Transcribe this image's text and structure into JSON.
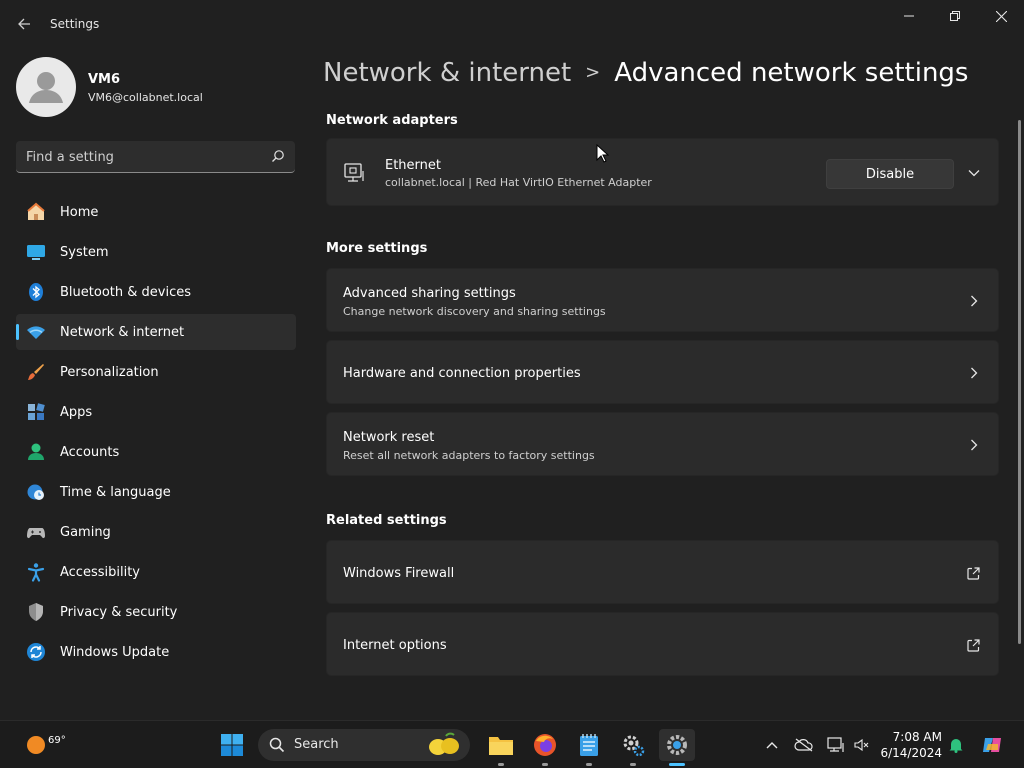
{
  "window": {
    "app_title": "Settings"
  },
  "profile": {
    "name": "VM6",
    "email": "VM6@collabnet.local"
  },
  "search": {
    "placeholder": "Find a setting"
  },
  "nav": {
    "items": [
      {
        "label": "Home",
        "icon": "home-icon"
      },
      {
        "label": "System",
        "icon": "system-monitor-icon"
      },
      {
        "label": "Bluetooth & devices",
        "icon": "bluetooth-icon"
      },
      {
        "label": "Network & internet",
        "icon": "wifi-icon",
        "active": true
      },
      {
        "label": "Personalization",
        "icon": "paintbrush-icon"
      },
      {
        "label": "Apps",
        "icon": "apps-icon"
      },
      {
        "label": "Accounts",
        "icon": "accounts-icon"
      },
      {
        "label": "Time & language",
        "icon": "clock-globe-icon"
      },
      {
        "label": "Gaming",
        "icon": "gamepad-icon"
      },
      {
        "label": "Accessibility",
        "icon": "accessibility-icon"
      },
      {
        "label": "Privacy & security",
        "icon": "shield-icon"
      },
      {
        "label": "Windows Update",
        "icon": "windows-update-icon"
      }
    ]
  },
  "breadcrumb": {
    "parent": "Network & internet",
    "separator": ">",
    "current": "Advanced network settings"
  },
  "sections": {
    "adapters": "Network adapters",
    "more": "More settings",
    "related": "Related settings"
  },
  "adapter": {
    "name": "Ethernet",
    "description": "collabnet.local | Red Hat VirtIO Ethernet Adapter",
    "button": "Disable"
  },
  "more_settings": [
    {
      "title": "Advanced sharing settings",
      "subtitle": "Change network discovery and sharing settings"
    },
    {
      "title": "Hardware and connection properties",
      "subtitle": ""
    },
    {
      "title": "Network reset",
      "subtitle": "Reset all network adapters to factory settings"
    }
  ],
  "related_settings": [
    {
      "title": "Windows Firewall"
    },
    {
      "title": "Internet options"
    }
  ],
  "taskbar": {
    "weather_temp": "69°",
    "search_label": "Search",
    "time": "7:08 AM",
    "date": "6/14/2024"
  },
  "colors": {
    "accent": "#4cc2ff",
    "background": "#202020",
    "card": "#2b2b2b"
  }
}
